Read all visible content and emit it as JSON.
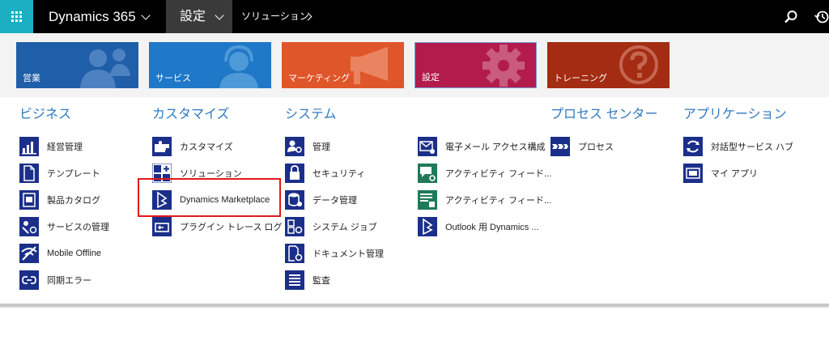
{
  "topbar": {
    "app_title": "Dynamics 365",
    "area": "設定",
    "breadcrumb": "ソリューション",
    "icons": [
      "waffle-icon",
      "search-icon",
      "history-icon"
    ],
    "colors": {
      "bar": "#000000",
      "waffle": "#1bafc1",
      "area": "#3a3a3a"
    }
  },
  "tiles": [
    {
      "label": "営業",
      "color": "#1f5ea8",
      "icon": "people-icon"
    },
    {
      "label": "サービス",
      "color": "#1f78c8",
      "icon": "headset-icon"
    },
    {
      "label": "マーケティング",
      "color": "#e0562b",
      "icon": "megaphone-icon"
    },
    {
      "label": "設定",
      "color": "#b21b4c",
      "icon": "gear-icon"
    },
    {
      "label": "トレーニング",
      "color": "#a32c12",
      "icon": "help-icon"
    }
  ],
  "columns": [
    {
      "title": "ビジネス",
      "items": [
        {
          "label": "経営管理"
        },
        {
          "label": "テンプレート"
        },
        {
          "label": "製品カタログ"
        },
        {
          "label": "サービスの管理"
        },
        {
          "label": "Mobile Offline"
        },
        {
          "label": "同期エラー"
        }
      ]
    },
    {
      "title": "カスタマイズ",
      "items": [
        {
          "label": "カスタマイズ"
        },
        {
          "label": "ソリューション"
        },
        {
          "label": "Dynamics Marketplace"
        },
        {
          "label": "プラグイン トレース ログ"
        }
      ]
    },
    {
      "title": "システム",
      "items": [
        {
          "label": "管理"
        },
        {
          "label": "セキュリティ"
        },
        {
          "label": "データ管理"
        },
        {
          "label": "システム ジョブ"
        },
        {
          "label": "ドキュメント管理"
        },
        {
          "label": "監査"
        }
      ]
    },
    {
      "title": "",
      "items": [
        {
          "label": "電子メール アクセス構成"
        },
        {
          "label": "アクティビティ フィード..."
        },
        {
          "label": "アクティビティ フィード..."
        },
        {
          "label": "Outlook 用 Dynamics ..."
        }
      ]
    },
    {
      "title": "プロセス センター",
      "items": [
        {
          "label": "プロセス"
        }
      ]
    },
    {
      "title": "アプリケーション",
      "items": [
        {
          "label": "対話型サービス ハブ"
        },
        {
          "label": "マイ アプリ"
        }
      ]
    }
  ],
  "colors": {
    "accent": "#2f7ac0",
    "icon_bg": "#1b2f8a",
    "icon_green": "#1f7a5a",
    "highlight": "#e11a1a"
  }
}
